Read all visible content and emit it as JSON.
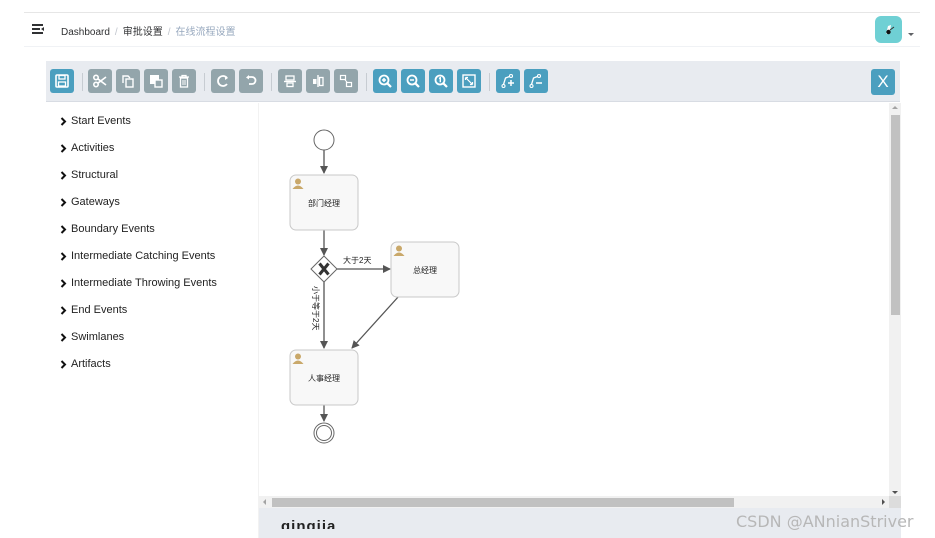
{
  "navbar": {
    "menu_icon": "hamburger-fold-icon",
    "breadcrumb": [
      "Dashboard",
      "审批设置",
      "在线流程设置"
    ],
    "avatar_icon": "user-avatar-icon"
  },
  "toolbar": {
    "buttons": [
      {
        "name": "save",
        "icon": "save-icon",
        "color": "blue"
      },
      {
        "name": "cut",
        "icon": "scissors-icon",
        "color": "grey"
      },
      {
        "name": "copy",
        "icon": "copy-icon",
        "color": "grey"
      },
      {
        "name": "paste",
        "icon": "paste-icon",
        "color": "grey"
      },
      {
        "name": "delete",
        "icon": "trash-icon",
        "color": "grey"
      },
      {
        "name": "redo",
        "icon": "redo-icon",
        "color": "grey"
      },
      {
        "name": "undo",
        "icon": "undo-icon",
        "color": "grey"
      },
      {
        "name": "align-horizontal",
        "icon": "align-horizontal-icon",
        "color": "grey"
      },
      {
        "name": "align-vertical",
        "icon": "align-vertical-icon",
        "color": "grey"
      },
      {
        "name": "same-size",
        "icon": "same-size-icon",
        "color": "grey"
      },
      {
        "name": "zoom-in",
        "icon": "zoom-in-icon",
        "color": "blue"
      },
      {
        "name": "zoom-out",
        "icon": "zoom-out-icon",
        "color": "blue"
      },
      {
        "name": "zoom-actual",
        "icon": "zoom-actual-icon",
        "color": "blue"
      },
      {
        "name": "zoom-fit",
        "icon": "zoom-fit-icon",
        "color": "blue"
      },
      {
        "name": "add-bendpoint",
        "icon": "add-bendpoint-icon",
        "color": "blue"
      },
      {
        "name": "remove-bendpoint",
        "icon": "remove-bendpoint-icon",
        "color": "blue"
      }
    ],
    "close_label": "X"
  },
  "palette": {
    "items": [
      "Start Events",
      "Activities",
      "Structural",
      "Gateways",
      "Boundary Events",
      "Intermediate Catching Events",
      "Intermediate Throwing Events",
      "End Events",
      "Swimlanes",
      "Artifacts"
    ]
  },
  "diagram": {
    "tasks": [
      "部门经理",
      "总经理",
      "人事经理"
    ],
    "flows": {
      "to_general_manager": "大于2天",
      "to_hr_manager": "小于等于2天"
    }
  },
  "properties": {
    "title": "qingjia"
  },
  "colors": {
    "accent_blue": "#4b9fbf",
    "disabled_grey": "#93a5ab",
    "toolbar_bg": "#e8ebf0",
    "avatar_bg": "#6fd0d4",
    "user_icon": "#c9a86a"
  },
  "watermark": "CSDN @ANnianStriver"
}
